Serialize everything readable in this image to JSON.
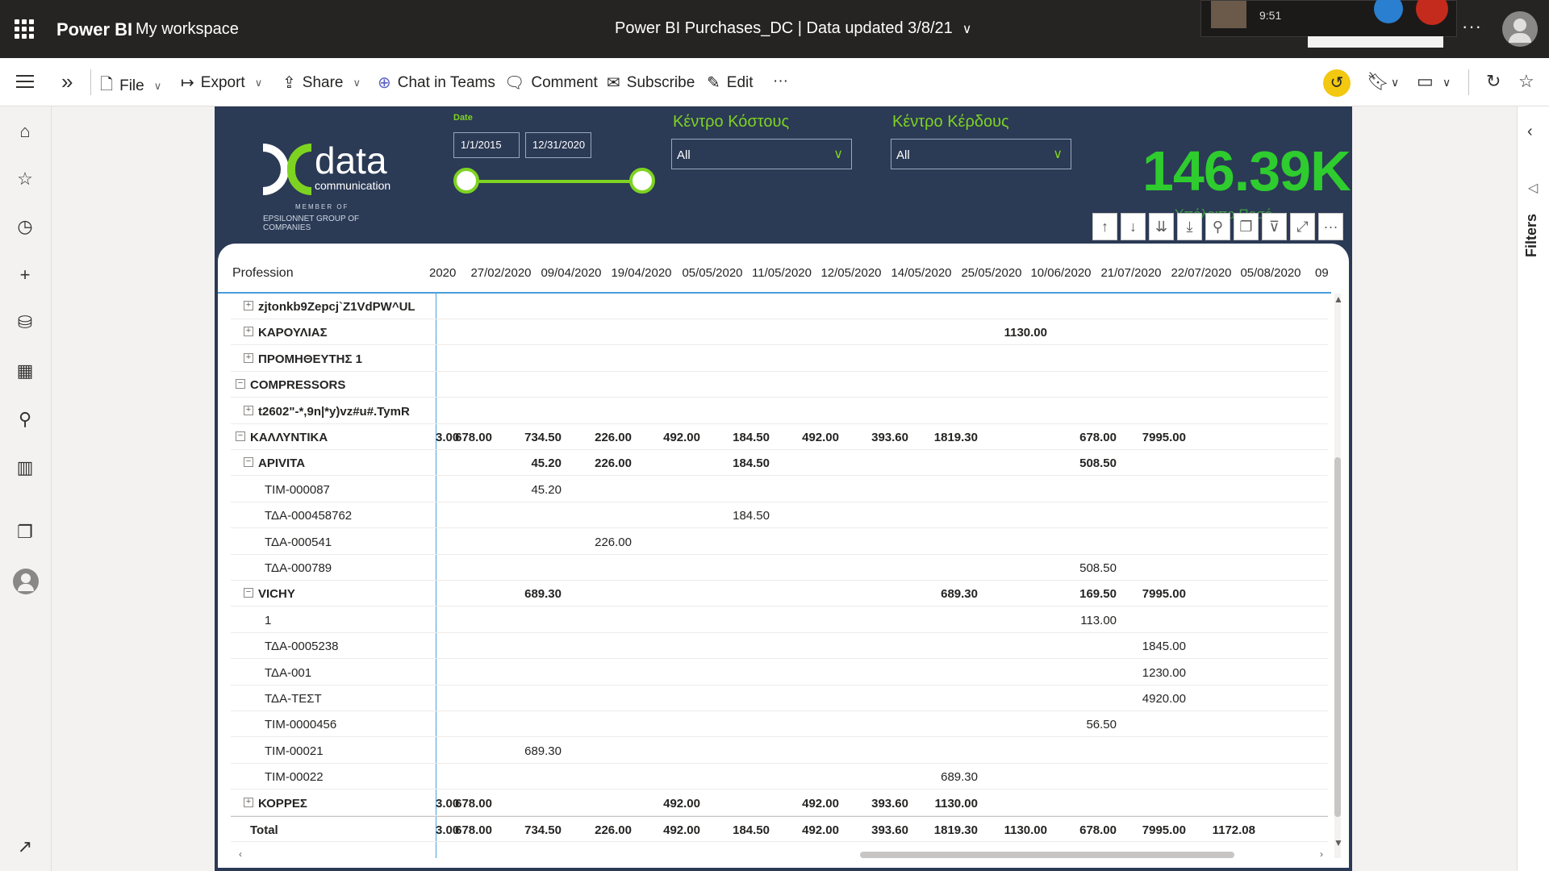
{
  "topbar": {
    "brand": "Power BI",
    "workspace": "My workspace",
    "report_title": "Power BI Purchases_DC  |  Data updated 3/8/21",
    "call_time": "9:51",
    "more": "···"
  },
  "actionbar": {
    "file": "File",
    "export": "Export",
    "share": "Share",
    "chat": "Chat in Teams",
    "comment": "Comment",
    "subscribe": "Subscribe",
    "edit": "Edit",
    "more": "···"
  },
  "report": {
    "logo": {
      "word": "data",
      "sub": "communication",
      "member": "MEMBER OF",
      "group": "EPSILONNET GROUP OF COMPANIES"
    },
    "date_slicer": {
      "label": "Date",
      "start": "1/1/2015",
      "end": "12/31/2020"
    },
    "cost_center": {
      "label": "Κέντρο Κόστους",
      "value": "All"
    },
    "profit_center": {
      "label": "Κέντρο Κέρδους",
      "value": "All"
    },
    "kpi": {
      "value": "146.39K",
      "caption": "Υπόλοιπο Ποσό"
    }
  },
  "matrix": {
    "row_header": "Profession",
    "columns": [
      "2020",
      "27/02/2020",
      "09/04/2020",
      "19/04/2020",
      "05/05/2020",
      "11/05/2020",
      "12/05/2020",
      "14/05/2020",
      "25/05/2020",
      "10/06/2020",
      "21/07/2020",
      "22/07/2020",
      "05/08/2020",
      "09"
    ],
    "rows": [
      {
        "label": "zjtonkb9Zepcj`Z1VdPW^UL",
        "level": 1,
        "pm": "+",
        "bold": true,
        "cells": [
          "",
          "",
          "",
          "",
          "",
          "",
          "",
          "",
          "",
          "",
          "",
          "",
          "",
          ""
        ]
      },
      {
        "label": "ΚΑΡΟΥΛΙΑΣ",
        "level": 1,
        "pm": "+",
        "bold": true,
        "cells": [
          "",
          "",
          "",
          "",
          "",
          "",
          "",
          "",
          "",
          "1130.00",
          "",
          "",
          "",
          ""
        ]
      },
      {
        "label": "ΠΡΟΜΗΘΕΥΤΗΣ 1",
        "level": 1,
        "pm": "+",
        "bold": true,
        "cells": [
          "",
          "",
          "",
          "",
          "",
          "",
          "",
          "",
          "",
          "",
          "",
          "",
          "",
          ""
        ]
      },
      {
        "label": "COMPRESSORS",
        "level": 0,
        "pm": "−",
        "bold": true,
        "cells": [
          "",
          "",
          "",
          "",
          "",
          "",
          "",
          "",
          "",
          "",
          "",
          "",
          "",
          ""
        ]
      },
      {
        "label": "t2602\"-*,9n|*y)vz#u#.TymR",
        "level": 1,
        "pm": "+",
        "bold": true,
        "cells": [
          "",
          "",
          "",
          "",
          "",
          "",
          "",
          "",
          "",
          "",
          "",
          "",
          "",
          ""
        ]
      },
      {
        "label": "ΚΑΛΛΥΝΤΙΚΑ",
        "level": 0,
        "pm": "−",
        "bold": true,
        "cells": [
          "3.00",
          "678.00",
          "734.50",
          "226.00",
          "492.00",
          "184.50",
          "492.00",
          "393.60",
          "1819.30",
          "",
          "678.00",
          "7995.00",
          "",
          ""
        ]
      },
      {
        "label": "APIVITA",
        "level": 1,
        "pm": "−",
        "bold": true,
        "cells": [
          "",
          "",
          "45.20",
          "226.00",
          "",
          "184.50",
          "",
          "",
          "",
          "",
          "508.50",
          "",
          "",
          ""
        ]
      },
      {
        "label": "ΤΙΜ-000087",
        "level": 2,
        "pm": "",
        "bold": false,
        "cells": [
          "",
          "",
          "45.20",
          "",
          "",
          "",
          "",
          "",
          "",
          "",
          "",
          "",
          "",
          ""
        ]
      },
      {
        "label": "ΤΔΑ-000458762",
        "level": 2,
        "pm": "",
        "bold": false,
        "cells": [
          "",
          "",
          "",
          "",
          "",
          "184.50",
          "",
          "",
          "",
          "",
          "",
          "",
          "",
          ""
        ]
      },
      {
        "label": "ΤΔΑ-000541",
        "level": 2,
        "pm": "",
        "bold": false,
        "cells": [
          "",
          "",
          "",
          "226.00",
          "",
          "",
          "",
          "",
          "",
          "",
          "",
          "",
          "",
          ""
        ]
      },
      {
        "label": "ΤΔΑ-000789",
        "level": 2,
        "pm": "",
        "bold": false,
        "cells": [
          "",
          "",
          "",
          "",
          "",
          "",
          "",
          "",
          "",
          "",
          "508.50",
          "",
          "",
          ""
        ]
      },
      {
        "label": "VICHY",
        "level": 1,
        "pm": "−",
        "bold": true,
        "cells": [
          "",
          "",
          "689.30",
          "",
          "",
          "",
          "",
          "",
          "689.30",
          "",
          "169.50",
          "7995.00",
          "",
          ""
        ]
      },
      {
        "label": "1",
        "level": 2,
        "pm": "",
        "bold": false,
        "cells": [
          "",
          "",
          "",
          "",
          "",
          "",
          "",
          "",
          "",
          "",
          "113.00",
          "",
          "",
          ""
        ]
      },
      {
        "label": "ΤΔΑ-0005238",
        "level": 2,
        "pm": "",
        "bold": false,
        "cells": [
          "",
          "",
          "",
          "",
          "",
          "",
          "",
          "",
          "",
          "",
          "",
          "1845.00",
          "",
          ""
        ]
      },
      {
        "label": "ΤΔΑ-001",
        "level": 2,
        "pm": "",
        "bold": false,
        "cells": [
          "",
          "",
          "",
          "",
          "",
          "",
          "",
          "",
          "",
          "",
          "",
          "1230.00",
          "",
          ""
        ]
      },
      {
        "label": "ΤΔΑ-ΤΕΣΤ",
        "level": 2,
        "pm": "",
        "bold": false,
        "cells": [
          "",
          "",
          "",
          "",
          "",
          "",
          "",
          "",
          "",
          "",
          "",
          "4920.00",
          "",
          ""
        ]
      },
      {
        "label": "ΤΙΜ-0000456",
        "level": 2,
        "pm": "",
        "bold": false,
        "cells": [
          "",
          "",
          "",
          "",
          "",
          "",
          "",
          "",
          "",
          "",
          "56.50",
          "",
          "",
          ""
        ]
      },
      {
        "label": "ΤΙΜ-00021",
        "level": 2,
        "pm": "",
        "bold": false,
        "cells": [
          "",
          "",
          "689.30",
          "",
          "",
          "",
          "",
          "",
          "",
          "",
          "",
          "",
          "",
          ""
        ]
      },
      {
        "label": "ΤΙΜ-00022",
        "level": 2,
        "pm": "",
        "bold": false,
        "cells": [
          "",
          "",
          "",
          "",
          "",
          "",
          "",
          "",
          "689.30",
          "",
          "",
          "",
          "",
          ""
        ]
      },
      {
        "label": "ΚΟΡΡΕΣ",
        "level": 1,
        "pm": "+",
        "bold": true,
        "cells": [
          "3.00",
          "678.00",
          "",
          "",
          "492.00",
          "",
          "492.00",
          "393.60",
          "1130.00",
          "",
          "",
          "",
          "",
          ""
        ]
      },
      {
        "label": "Total",
        "level": 0,
        "pm": "",
        "bold": true,
        "total": true,
        "cells": [
          "3.00",
          "678.00",
          "734.50",
          "226.00",
          "492.00",
          "184.50",
          "492.00",
          "393.60",
          "1819.30",
          "1130.00",
          "678.00",
          "7995.00",
          "1172.08",
          ""
        ]
      }
    ]
  },
  "filters": {
    "label": "Filters"
  }
}
